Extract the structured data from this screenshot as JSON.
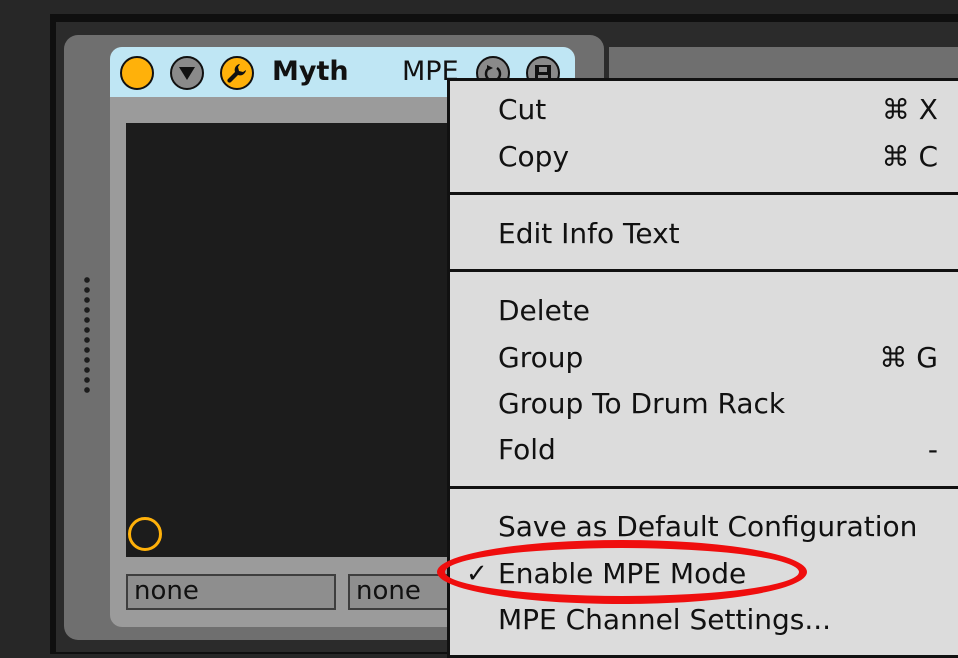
{
  "device": {
    "title": "Myth",
    "mode_label": "MPE",
    "selectors": [
      "none",
      "none"
    ],
    "icons": {
      "activator": "circle-icon",
      "fold": "triangle-down-icon",
      "edit": "wrench-icon",
      "hot_swap": "hot-swap-icon",
      "save": "save-icon"
    },
    "colors": {
      "accent": "#ffb10a",
      "header": "#bfe6f4",
      "pad": "#1c1c1c"
    }
  },
  "context_menu": {
    "items": [
      {
        "label": "Cut",
        "shortcut": "⌘ X"
      },
      {
        "label": "Copy",
        "shortcut": "⌘ C"
      },
      {
        "label": "Edit Info Text",
        "shortcut": ""
      },
      {
        "label": "Delete",
        "shortcut": ""
      },
      {
        "label": "Group",
        "shortcut": "⌘ G"
      },
      {
        "label": "Group To Drum Rack",
        "shortcut": ""
      },
      {
        "label": "Fold",
        "shortcut": "-"
      },
      {
        "label": "Save as Default Configuration",
        "shortcut": ""
      },
      {
        "label": "Enable MPE Mode",
        "shortcut": "",
        "checked": true
      },
      {
        "label": "MPE Channel Settings...",
        "shortcut": ""
      }
    ],
    "check_mark": "✓",
    "highlight_color": "#ef0e0e"
  }
}
